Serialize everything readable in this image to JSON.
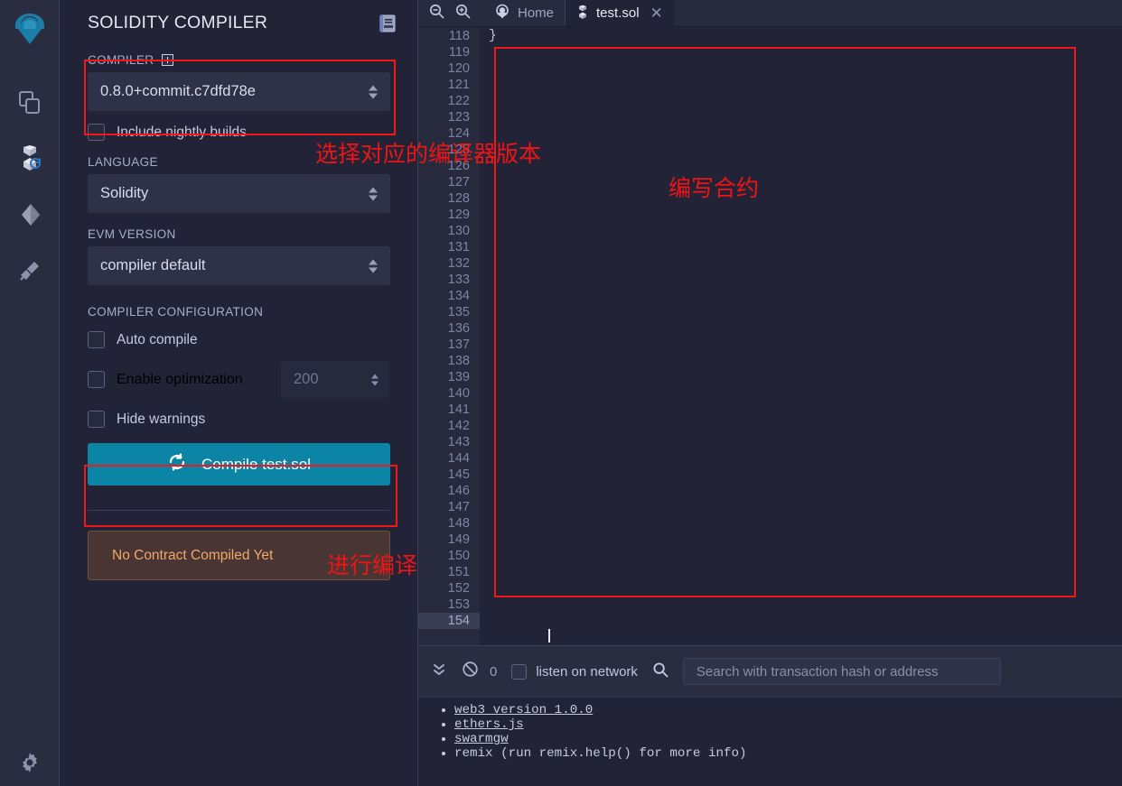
{
  "iconbar": {
    "items": [
      {
        "name": "remix-logo-icon",
        "label": "Remix"
      },
      {
        "name": "file-explorers-icon",
        "label": "File explorers"
      },
      {
        "name": "solidity-compiler-icon",
        "label": "Solidity compiler"
      },
      {
        "name": "deploy-run-icon",
        "label": "Deploy & run transactions"
      },
      {
        "name": "plugin-manager-icon",
        "label": "Plugin manager"
      }
    ],
    "settings_label": "Settings"
  },
  "panel": {
    "title": "SOLIDITY COMPILER",
    "header_icon": "article-icon",
    "compiler_label": "COMPILER",
    "compiler_add_icon": "plus-square-icon",
    "compiler_version": "0.8.0+commit.c7dfd78e",
    "nightly_label": "Include nightly builds",
    "language_label": "LANGUAGE",
    "language_value": "Solidity",
    "evm_label": "EVM VERSION",
    "evm_value": "compiler default",
    "config_label": "COMPILER CONFIGURATION",
    "auto_compile_label": "Auto compile",
    "enable_optimization_label": "Enable optimization",
    "optimization_runs": "200",
    "hide_warnings_label": "Hide warnings",
    "compile_button_label": "Compile test.sol",
    "compile_button_icon": "refresh-icon",
    "compile_button_color": "#0b84a5",
    "status_text": "No Contract Compiled Yet",
    "status_color": "#f0a868"
  },
  "tabbar": {
    "zoom_out_icon": "zoom-out-icon",
    "zoom_in_icon": "zoom-in-icon",
    "home_icon": "remix-home-icon",
    "home_label": "Home",
    "file_icon": "solidity-file-icon",
    "file_label": "test.sol",
    "close_icon": "close-icon"
  },
  "editor": {
    "first_line": 118,
    "last_line": 154,
    "active_line": 154,
    "code_lines": [
      {
        "line": 118,
        "text": "}"
      }
    ]
  },
  "terminal": {
    "collapse_icon": "chevrons-down-icon",
    "clear_icon": "ban-icon",
    "count": "0",
    "listen_label": "listen on network",
    "search_icon": "search-icon",
    "search_placeholder": "Search with transaction hash or address",
    "log_items": [
      {
        "text": "web3 version 1.0.0",
        "link": true
      },
      {
        "text": "ethers.js",
        "link": true
      },
      {
        "text": "swarmgw",
        "link": true
      },
      {
        "text": "remix (run remix.help() for more info)",
        "link": false
      }
    ]
  },
  "annotations": {
    "accent_color": "#f01414",
    "compiler_note": "选择对应的编译器版本",
    "editor_note": "编写合约",
    "compile_note": "进行编译"
  }
}
